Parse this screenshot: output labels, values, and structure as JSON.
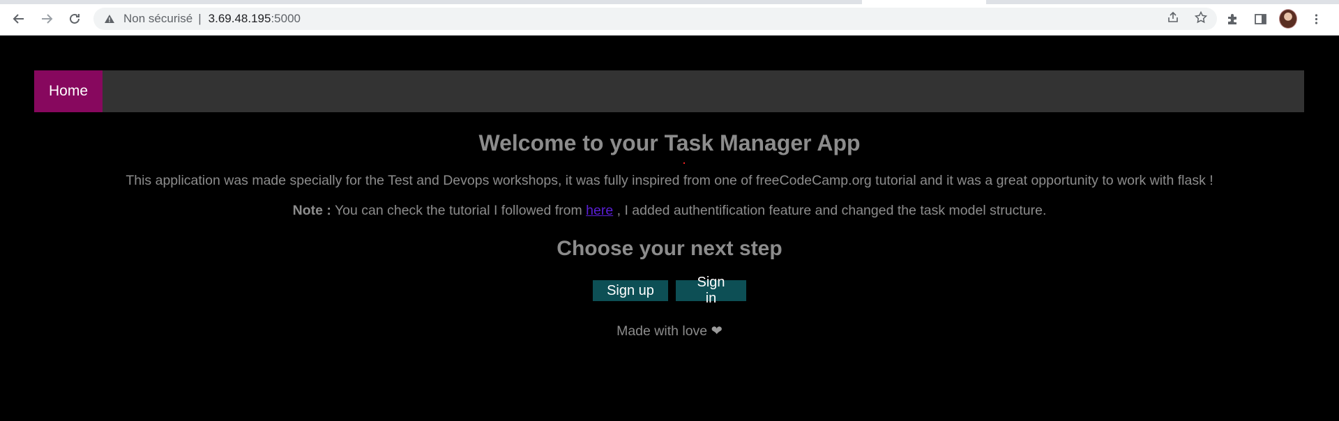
{
  "browser": {
    "security_label": "Non sécurisé",
    "separator": "|",
    "host": "3.69.48.195",
    "port": ":5000"
  },
  "nav": {
    "home_label": "Home",
    "home_color": "#87085e",
    "bar_color": "#333333"
  },
  "main": {
    "title": "Welcome to your Task Manager App",
    "description": "This application was made specially for the Test and Devops workshops, it was fully inspired from one of freeCodeCamp.org tutorial and it was a great opportunity to work with flask !",
    "note_label": "Note :",
    "note_text_before": " You can check the tutorial I followed from ",
    "note_link": "here",
    "note_text_after": " , I added authentification feature and changed the task model structure.",
    "subtitle": "Choose your next step",
    "signup_label": "Sign up",
    "signin_label": "Sign in",
    "button_color": "#0d4f55",
    "footer_text": "Made with love",
    "footer_icon": "heart-icon"
  }
}
